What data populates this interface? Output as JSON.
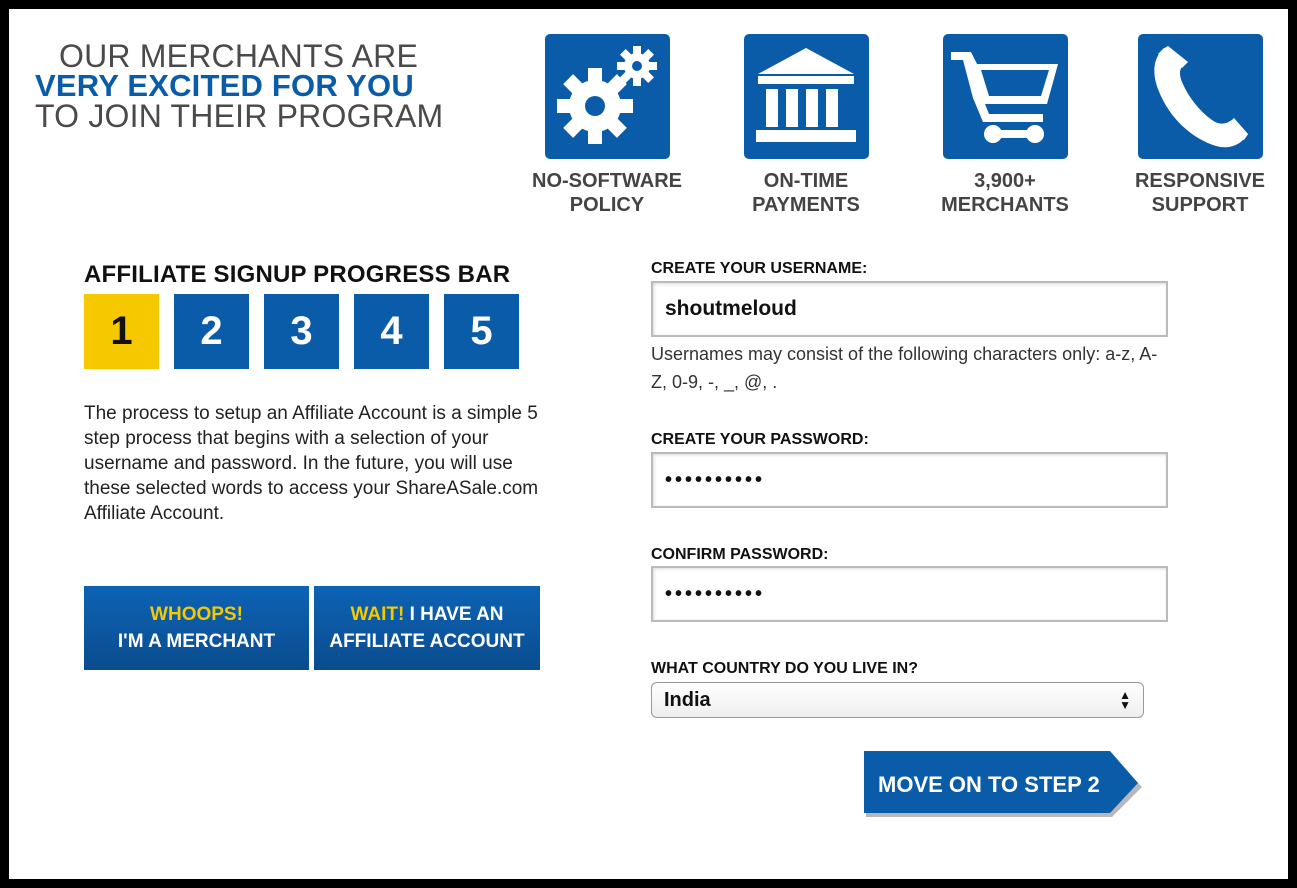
{
  "headline": {
    "line1": "OUR MERCHANTS ARE",
    "line2": "VERY EXCITED FOR YOU",
    "line3": "TO JOIN THEIR PROGRAM"
  },
  "features": [
    {
      "icon": "gears-icon",
      "line1": "NO-SOFTWARE",
      "line2": "POLICY"
    },
    {
      "icon": "bank-icon",
      "line1": "ON-TIME",
      "line2": "PAYMENTS"
    },
    {
      "icon": "cart-icon",
      "line1": "3,900+",
      "line2": "MERCHANTS"
    },
    {
      "icon": "phone-icon",
      "line1": "RESPONSIVE",
      "line2": "SUPPORT"
    }
  ],
  "progress": {
    "title": "AFFILIATE SIGNUP PROGRESS BAR",
    "steps": [
      "1",
      "2",
      "3",
      "4",
      "5"
    ],
    "current_step": 1
  },
  "intro": "The process to setup an Affiliate Account is a simple 5 step process that begins with a selection of your username and password. In the future, you will use these selected words to access your ShareASale.com Affiliate Account.",
  "buttons": {
    "merchant_highlight": "WHOOPS!",
    "merchant_text": "I'M A MERCHANT",
    "account_highlight": "WAIT!",
    "account_text1": " I HAVE AN",
    "account_text2": "AFFILIATE ACCOUNT",
    "next": "MOVE ON TO STEP 2"
  },
  "form": {
    "username_label": "CREATE YOUR USERNAME:",
    "username_value": "shoutmeloud",
    "username_hint": "Usernames may consist of the following characters only: a-z, A-Z, 0-9, -, _, @, .",
    "password_label": "CREATE YOUR PASSWORD:",
    "password_value": "••••••••••",
    "confirm_label": "CONFIRM PASSWORD:",
    "confirm_value": "••••••••••",
    "country_label": "WHAT COUNTRY DO YOU LIVE IN?",
    "country_value": "India"
  },
  "colors": {
    "brand_blue": "#0b5ca8",
    "accent_yellow": "#f5c800"
  }
}
